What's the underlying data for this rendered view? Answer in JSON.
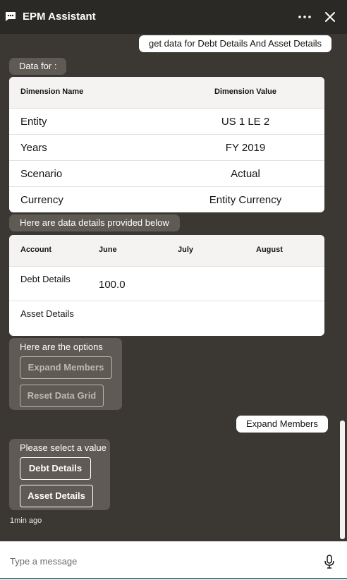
{
  "header": {
    "title": "EPM Assistant",
    "icons": {
      "chat": "chat-bubble-icon",
      "more": "more-options-icon",
      "close": "close-icon"
    }
  },
  "messages": {
    "user_query": "get data for Debt Details And Asset Details",
    "data_for_label": "Data for :",
    "dimension_table": {
      "headers": [
        "Dimension Name",
        "Dimension Value"
      ],
      "rows": [
        [
          "Entity",
          "US 1 LE 2"
        ],
        [
          "Years",
          "FY 2019"
        ],
        [
          "Scenario",
          "Actual"
        ],
        [
          "Currency",
          "Entity Currency"
        ]
      ]
    },
    "data_details_label": "Here are data details provided below",
    "data_table": {
      "headers": [
        "Account",
        "June",
        "July",
        "August"
      ],
      "rows": [
        [
          "Debt Details",
          "100.0",
          "",
          ""
        ],
        [
          "Asset Details",
          "",
          "",
          ""
        ]
      ]
    },
    "options_prompt": "Here are the options",
    "options": [
      "Expand Members",
      "Reset Data Grid"
    ],
    "user_choice": "Expand Members",
    "select_prompt": "Please select a value",
    "select_options": [
      "Debt Details",
      "Asset Details"
    ],
    "timestamp": "1min ago"
  },
  "footer": {
    "placeholder": "Type a message",
    "mic_icon": "microphone-icon"
  },
  "colors": {
    "background": "#3b3833",
    "header": "#2b2925",
    "bubble": "#5f5a53",
    "card": "#ffffff"
  }
}
